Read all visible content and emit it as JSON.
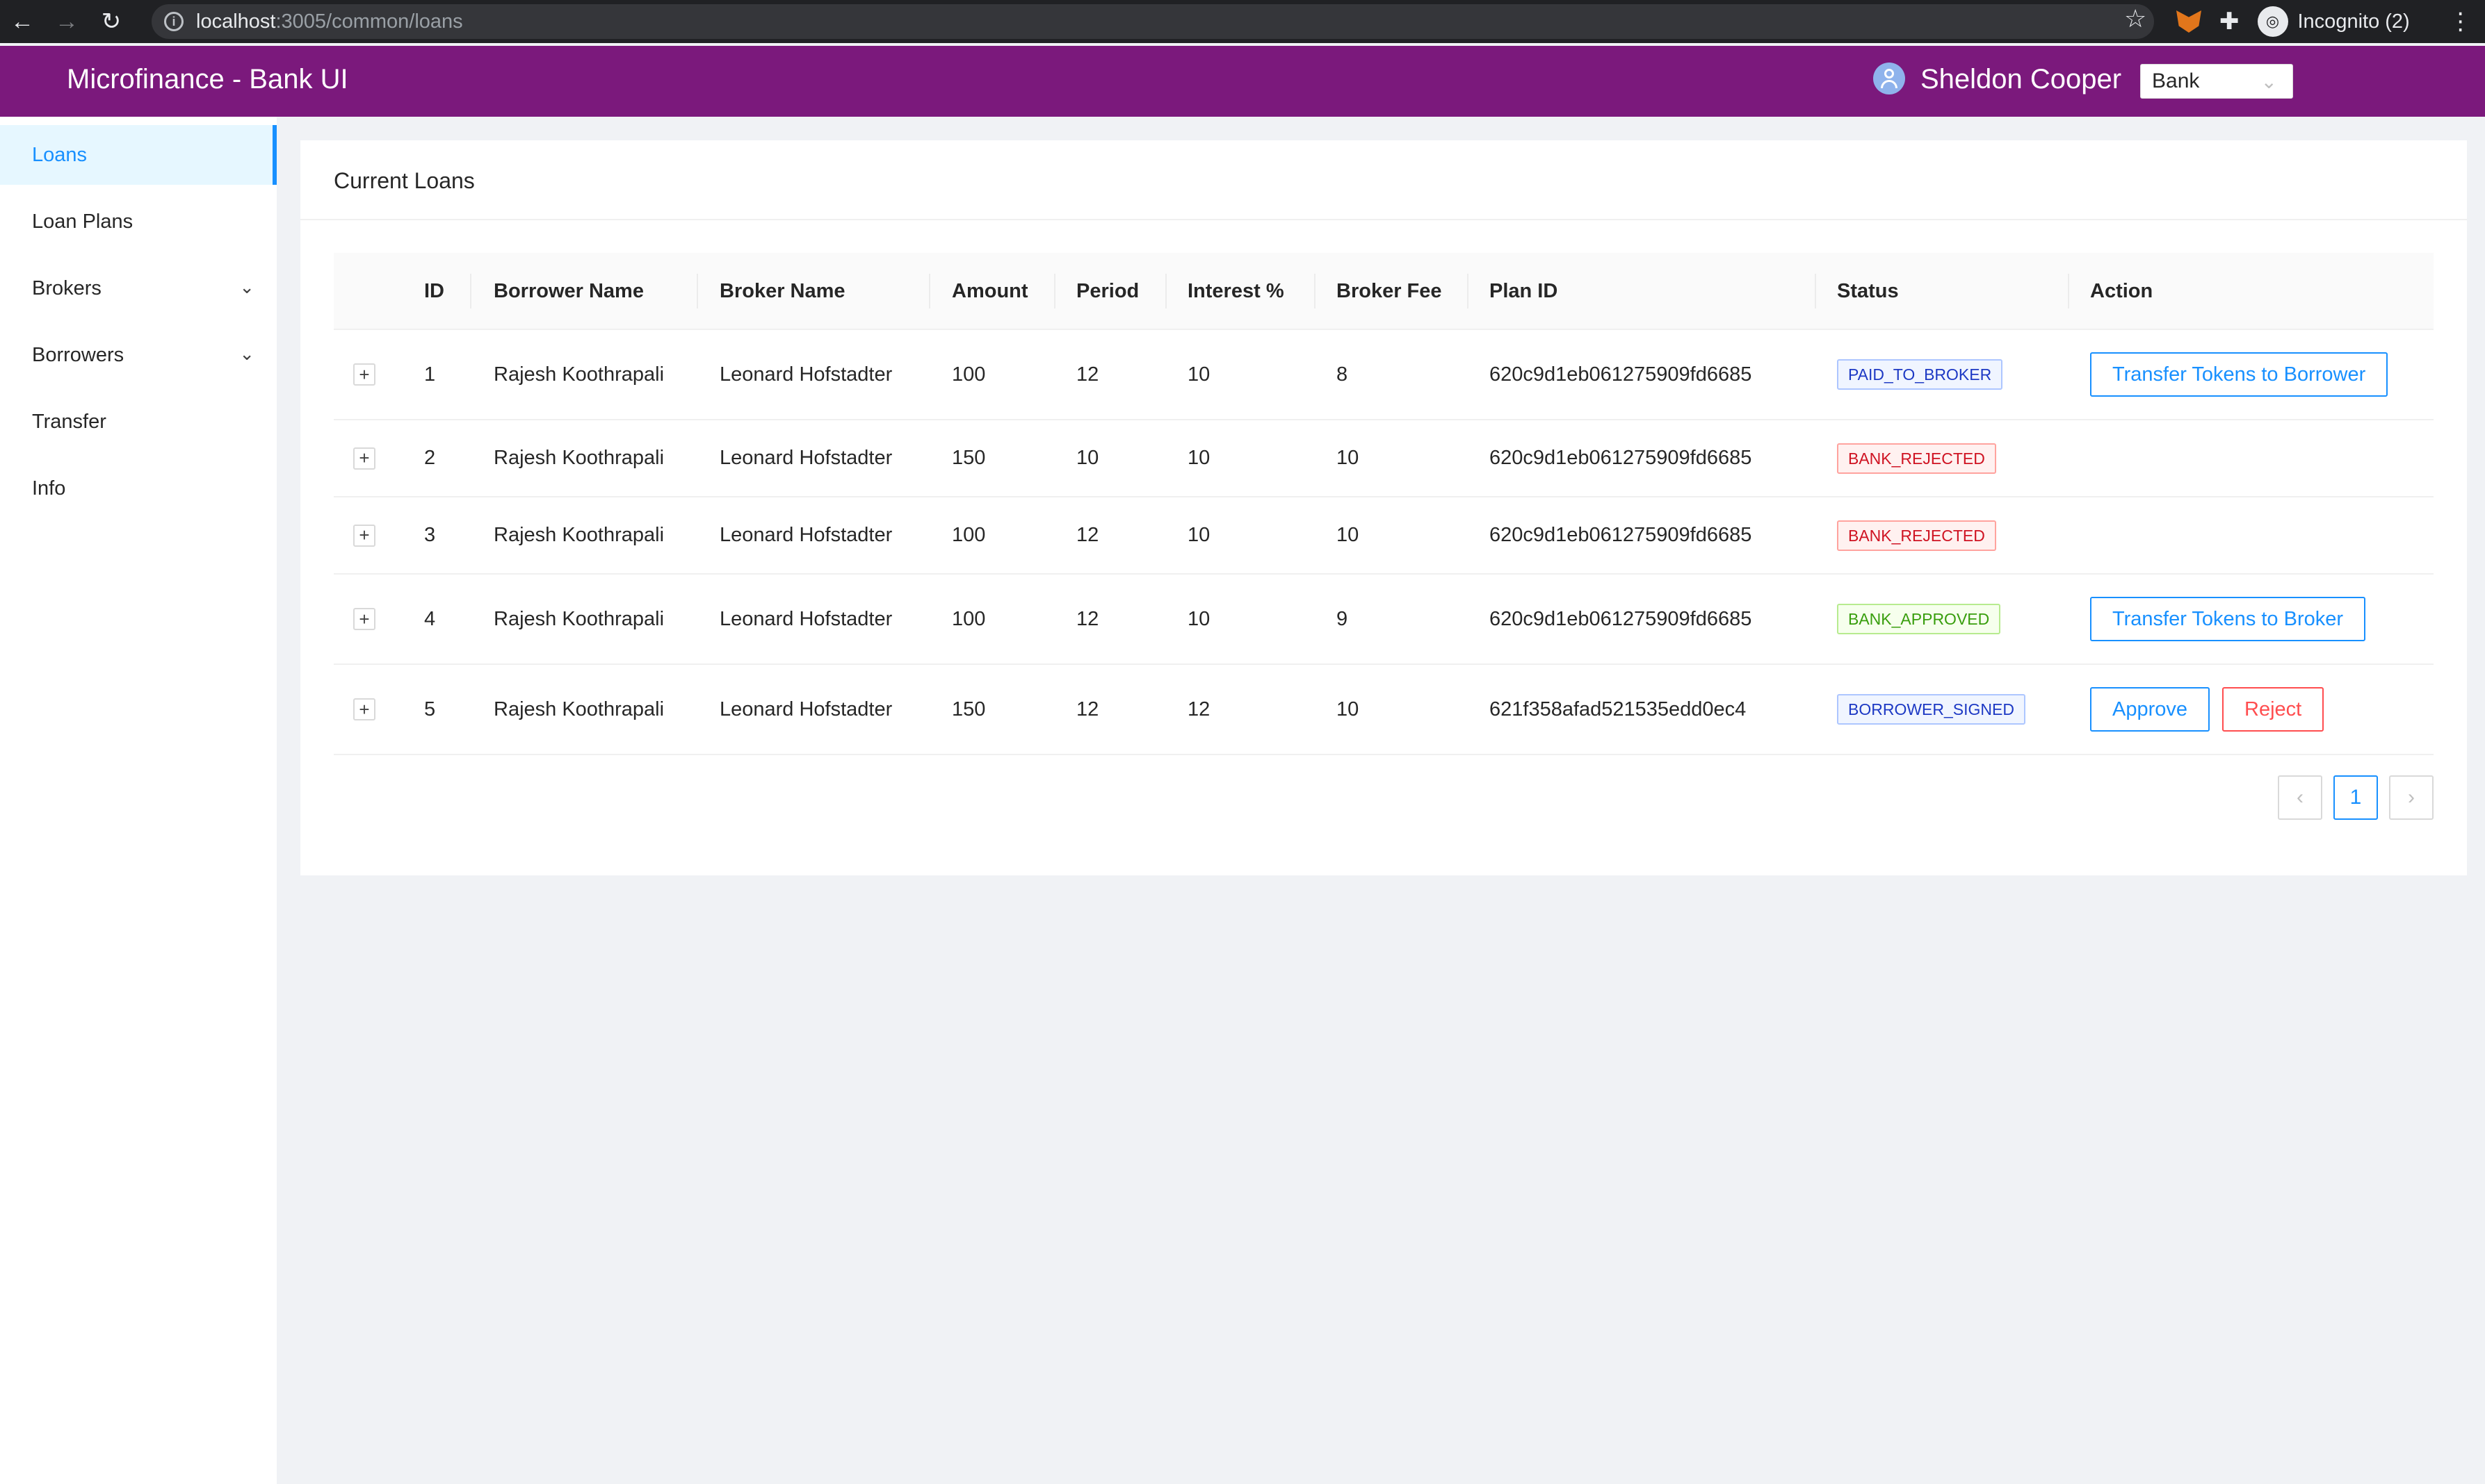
{
  "browser": {
    "url_host": "localhost",
    "url_path": ":3005/common/loans",
    "incognito_label": "Incognito (2)"
  },
  "header": {
    "app_title": "Microfinance - Bank UI",
    "user_name": "Sheldon Cooper",
    "role_selected": "Bank"
  },
  "sidebar": {
    "items": [
      {
        "label": "Loans",
        "active": true
      },
      {
        "label": "Loan Plans"
      },
      {
        "label": "Brokers",
        "expandable": true
      },
      {
        "label": "Borrowers",
        "expandable": true
      },
      {
        "label": "Transfer"
      },
      {
        "label": "Info"
      }
    ]
  },
  "main": {
    "title": "Current Loans",
    "columns": [
      "ID",
      "Borrower Name",
      "Broker Name",
      "Amount",
      "Period",
      "Interest %",
      "Broker Fee",
      "Plan ID",
      "Status",
      "Action"
    ],
    "rows": [
      {
        "id": "1",
        "borrower": "Rajesh Koothrapali",
        "broker": "Leonard Hofstadter",
        "amount": "100",
        "period": "12",
        "interest": "10",
        "broker_fee": "8",
        "plan_id": "620c9d1eb061275909fd6685",
        "status": "PAID_TO_BROKER",
        "status_color": "blue",
        "actions": [
          "Transfer Tokens to Borrower"
        ]
      },
      {
        "id": "2",
        "borrower": "Rajesh Koothrapali",
        "broker": "Leonard Hofstadter",
        "amount": "150",
        "period": "10",
        "interest": "10",
        "broker_fee": "10",
        "plan_id": "620c9d1eb061275909fd6685",
        "status": "BANK_REJECTED",
        "status_color": "red",
        "actions": []
      },
      {
        "id": "3",
        "borrower": "Rajesh Koothrapali",
        "broker": "Leonard Hofstadter",
        "amount": "100",
        "period": "12",
        "interest": "10",
        "broker_fee": "10",
        "plan_id": "620c9d1eb061275909fd6685",
        "status": "BANK_REJECTED",
        "status_color": "red",
        "actions": []
      },
      {
        "id": "4",
        "borrower": "Rajesh Koothrapali",
        "broker": "Leonard Hofstadter",
        "amount": "100",
        "period": "12",
        "interest": "10",
        "broker_fee": "9",
        "plan_id": "620c9d1eb061275909fd6685",
        "status": "BANK_APPROVED",
        "status_color": "green",
        "actions": [
          "Transfer Tokens to Broker"
        ]
      },
      {
        "id": "5",
        "borrower": "Rajesh Koothrapali",
        "broker": "Leonard Hofstadter",
        "amount": "150",
        "period": "12",
        "interest": "12",
        "broker_fee": "10",
        "plan_id": "621f358afad521535edd0ec4",
        "status": "BORROWER_SIGNED",
        "status_color": "blue",
        "actions": [
          "Approve",
          "Reject"
        ]
      }
    ],
    "pagination": {
      "current_page": "1"
    }
  },
  "colors": {
    "header_bg": "#7b197c",
    "accent": "#1890ff",
    "danger": "#ff4d4f"
  }
}
